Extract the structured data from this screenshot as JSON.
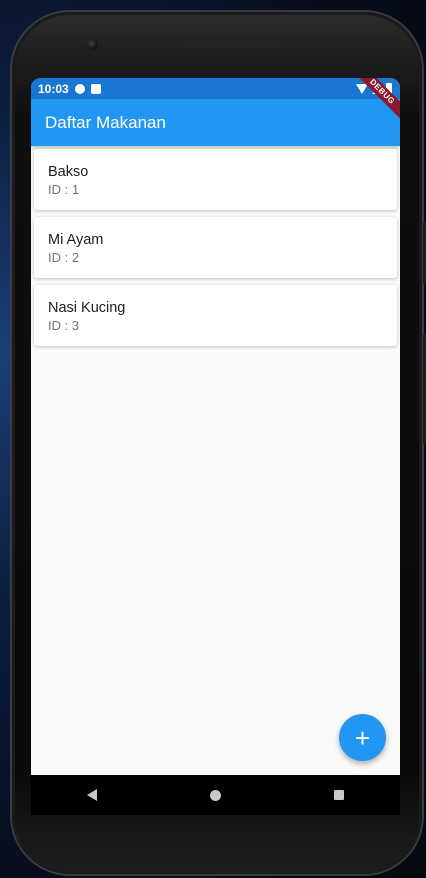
{
  "status_bar": {
    "time": "10:03"
  },
  "app_bar": {
    "title": "Daftar Makanan"
  },
  "debug_banner": "DEBUG",
  "foods": [
    {
      "name": "Bakso",
      "id_label": "ID : 1"
    },
    {
      "name": "Mi Ayam",
      "id_label": "ID : 2"
    },
    {
      "name": "Nasi Kucing",
      "id_label": "ID : 3"
    }
  ],
  "fab": {
    "icon": "add-icon",
    "glyph": "+"
  },
  "colors": {
    "primary": "#2196f3",
    "primary_dark": "#1976d2",
    "debug": "#8b1a2c"
  }
}
